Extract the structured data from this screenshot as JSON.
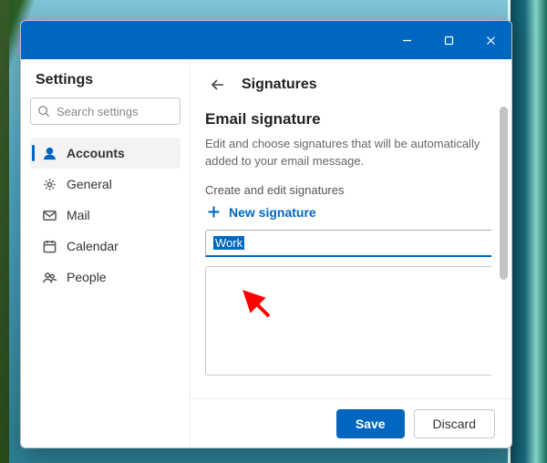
{
  "window": {
    "minimize_tooltip": "Minimize",
    "maximize_tooltip": "Maximize",
    "close_tooltip": "Close"
  },
  "sidebar": {
    "title": "Settings",
    "search_placeholder": "Search settings",
    "items": [
      {
        "icon": "person",
        "label": "Accounts",
        "active": true
      },
      {
        "icon": "gear",
        "label": "General",
        "active": false
      },
      {
        "icon": "mail",
        "label": "Mail",
        "active": false
      },
      {
        "icon": "calendar",
        "label": "Calendar",
        "active": false
      },
      {
        "icon": "people",
        "label": "People",
        "active": false
      }
    ]
  },
  "main": {
    "page_title": "Signatures",
    "section_title": "Email signature",
    "description": "Edit and choose signatures that will be automatically added to your email message.",
    "subheading": "Create and edit signatures",
    "new_signature_label": "New signature",
    "signature_name_value": "Work",
    "signature_body_value": ""
  },
  "footer": {
    "save_label": "Save",
    "discard_label": "Discard"
  },
  "colors": {
    "accent": "#0067c0",
    "annotation_arrow": "#ff0000"
  }
}
